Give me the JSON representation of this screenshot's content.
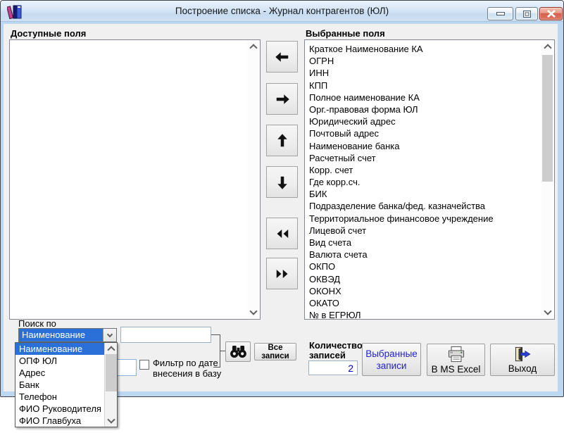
{
  "window": {
    "title": "Построение списка - Журнал контрагентов (ЮЛ)",
    "controls": {
      "minimize": "minimize",
      "maximize": "maximize",
      "close": "close"
    }
  },
  "panels": {
    "available": {
      "label": "Доступные поля",
      "items": []
    },
    "selected": {
      "label": "Выбранные поля",
      "items": [
        "Краткое Наименование КА",
        "ОГРН",
        "ИНН",
        "КПП",
        "Полное наименование КА",
        "Орг.-правовая форма ЮЛ",
        "Юридический адрес",
        "Почтовый адрес",
        "Наименование банка",
        "Расчетный счет",
        "Корр. счет",
        "Где корр.сч.",
        "БИК",
        "Подразделение банка/фед. казначейства",
        "Территориальное финансовое учреждение",
        "Лицевой счет",
        "Вид счета",
        "Валюта счета",
        "ОКПО",
        "ОКВЭД",
        "ОКОНХ",
        "ОКАТО",
        "№ в ЕГРЮЛ"
      ]
    }
  },
  "transfer_buttons": [
    "move-left",
    "move-right",
    "move-up",
    "move-down",
    "move-all-left",
    "move-all-right"
  ],
  "search": {
    "label": "Поиск по",
    "combo_value": "Наименование",
    "options": [
      "Наименование",
      "ОПФ ЮЛ",
      "Адрес",
      "Банк",
      "Телефон",
      "ФИО Руководителя",
      "ФИО Главбуха"
    ],
    "selected_option_index": 0,
    "input_value": "",
    "date_value": "",
    "filter_label": "Фильтр по дате внесения в базу",
    "filter_checked": false
  },
  "actions": {
    "all_records_label": "Все записи",
    "count_label": "Количество записей",
    "count_value": "2",
    "selected_records_label": "Выбранные записи",
    "excel_label": "В MS Excel",
    "exit_label": "Выход"
  },
  "icons": {
    "books-icon": "stack of leaning books (title bar app icon)",
    "binoculars-icon": "black binoculars (find)",
    "printer-icon": "printer (export to Excel)",
    "exit-door-icon": "door with blue arrow (exit)",
    "arrow-left-icon": "◄",
    "arrow-right-icon": "►",
    "arrow-up-icon": "▲",
    "arrow-down-icon": "▼",
    "double-arrow-left-icon": "◄◄",
    "double-arrow-right-icon": "►►",
    "chevron-down-icon": "v"
  },
  "colors": {
    "selection_blue": "#2a70d8",
    "link_blue": "#2222cc",
    "value_blue": "#0000cc",
    "close_red": "#d2604a",
    "frame_blue": "#bdd7f1",
    "client_gray": "#f0f0f0"
  }
}
